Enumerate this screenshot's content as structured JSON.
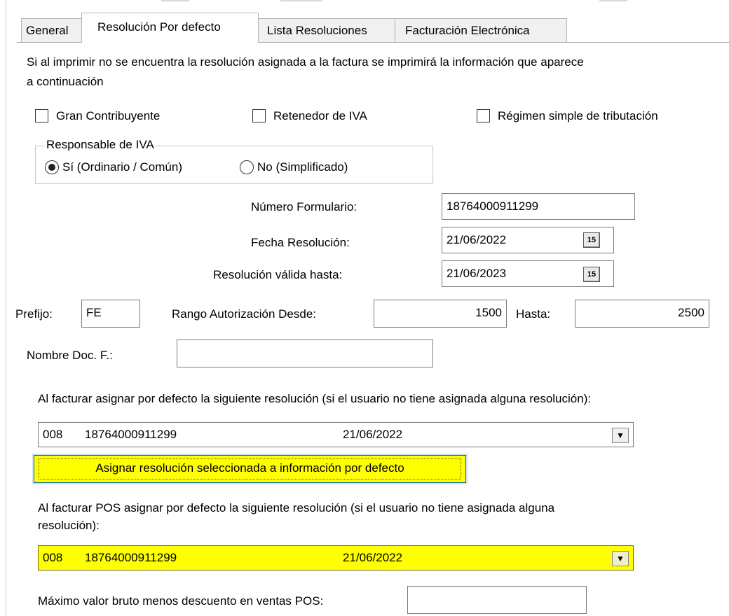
{
  "tabs": [
    "General",
    "Resolución Por defecto",
    "Lista Resoluciones",
    "Facturación Electrónica"
  ],
  "info_text_line1": "Si al imprimir no se encuentra la resolución asignada a la factura se imprimirá la información que aparece",
  "info_text_line2": "a continuación",
  "checkboxes": {
    "gran_contribuyente": "Gran Contribuyente",
    "retenedor_iva": "Retenedor de IVA",
    "regimen_simple": "Régimen simple de tributación"
  },
  "responsable_iva": {
    "legend": "Responsable de IVA",
    "opt_si": "Sí (Ordinario / Común)",
    "opt_no": "No (Simplificado)"
  },
  "form": {
    "numero_formulario_label": "Número Formulario:",
    "numero_formulario_value": "18764000911299",
    "fecha_resolucion_label": "Fecha Resolución:",
    "fecha_resolucion_value": "21/06/2022",
    "valida_hasta_label": "Resolución válida hasta:",
    "valida_hasta_value": "21/06/2023",
    "calendar_icon_text": "15",
    "prefijo_label": "Prefijo:",
    "prefijo_value": "FE",
    "rango_desde_label": "Rango Autorización Desde:",
    "rango_desde_value": "1500",
    "hasta_label": "Hasta:",
    "hasta_value": "2500",
    "nombre_doc_label": "Nombre Doc. F.:",
    "nombre_doc_value": ""
  },
  "default_resolution": {
    "label": "Al facturar asignar por defecto la siguiente resolución (si el usuario no tiene asignada alguna resolución):",
    "code": "008",
    "number": "18764000911299",
    "date": "21/06/2022"
  },
  "assign_button": "Asignar resolución seleccionada a información por defecto",
  "pos_resolution": {
    "label_line1": "Al facturar POS asignar por defecto la siguiente resolución (si el usuario no tiene asignada alguna",
    "label_line2": "resolución):",
    "code": "008",
    "number": "18764000911299",
    "date": "21/06/2022"
  },
  "max_pos": {
    "label": "Máximo valor bruto menos descuento en ventas POS:",
    "value": ""
  },
  "colors": {
    "highlight": "#ffff00",
    "focus_border": "#0b5fb0"
  },
  "icons": {
    "calendar": "calendar-icon",
    "dropdown": "chevron-down-icon"
  }
}
